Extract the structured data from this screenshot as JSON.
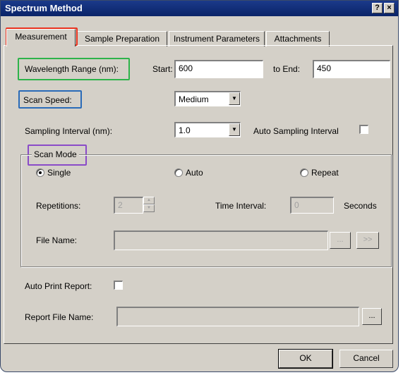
{
  "window": {
    "title": "Spectrum Method",
    "help_label": "?",
    "close_label": "×"
  },
  "tabs": [
    {
      "label": "Measurement",
      "active": true
    },
    {
      "label": "Sample Preparation",
      "active": false
    },
    {
      "label": "Instrument Parameters",
      "active": false
    },
    {
      "label": "Attachments",
      "active": false
    }
  ],
  "wavelength": {
    "label": "Wavelength Range (nm):",
    "start_label": "Start:",
    "start_value": "600",
    "end_label": "to End:",
    "end_value": "450"
  },
  "scan_speed": {
    "label": "Scan Speed:",
    "value": "Medium"
  },
  "sampling": {
    "label": "Sampling Interval (nm):",
    "value": "1.0",
    "auto_label": "Auto Sampling Interval",
    "auto_checked": false
  },
  "scan_mode": {
    "title": "Scan Mode",
    "options": [
      {
        "label": "Single",
        "selected": true
      },
      {
        "label": "Auto",
        "selected": false
      },
      {
        "label": "Repeat",
        "selected": false
      }
    ],
    "repetitions_label": "Repetitions:",
    "repetitions_value": "2",
    "time_interval_label": "Time Interval:",
    "time_interval_value": "0",
    "seconds_label": "Seconds",
    "file_name_label": "File Name:",
    "file_name_value": "",
    "browse_label": "...",
    "next_label": ">>"
  },
  "auto_print": {
    "label": "Auto Print Report:",
    "checked": false
  },
  "report_file": {
    "label": "Report File Name:",
    "value": "",
    "browse_label": "..."
  },
  "buttons": {
    "ok": "OK",
    "cancel": "Cancel"
  },
  "colors": {
    "highlight_measurement": "#e8321e",
    "highlight_wavelength": "#2db34a",
    "highlight_scan_speed": "#2a6bb8",
    "highlight_scan_mode": "#8a4bc8"
  }
}
